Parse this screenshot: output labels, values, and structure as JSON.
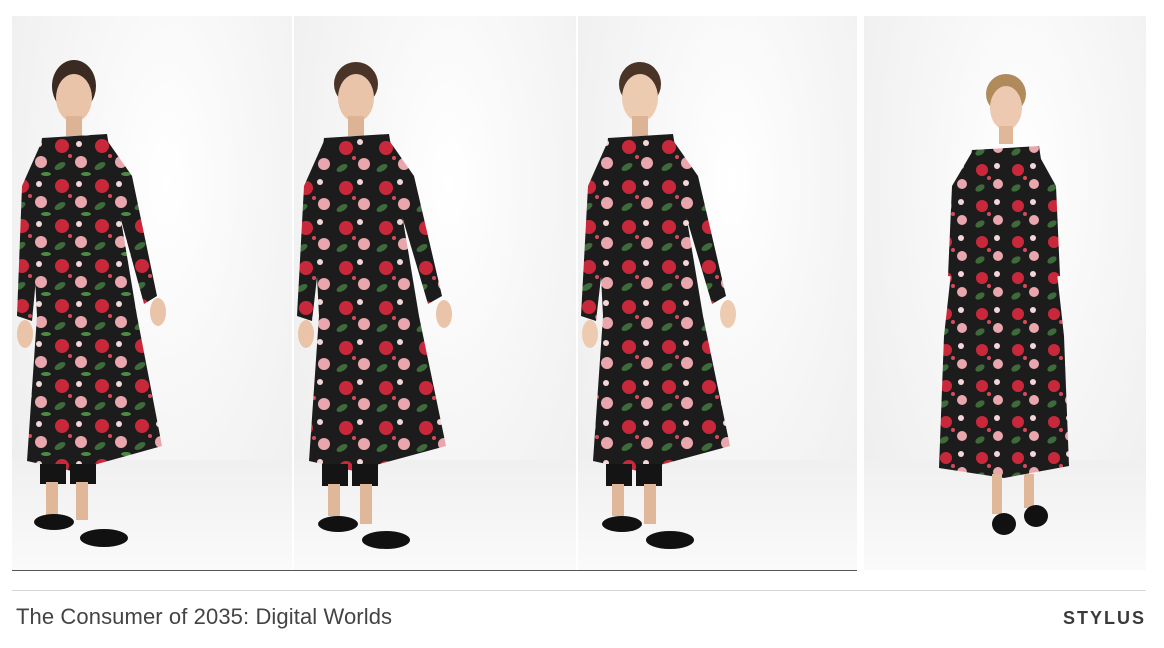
{
  "caption": {
    "title": "The Consumer of 2035: Digital Worlds"
  },
  "brand": {
    "name": "STYLUS"
  },
  "colors": {
    "dress_base": "#1c1c1c",
    "flower_red": "#c8283a",
    "flower_pink": "#e9a6ad",
    "leaf_green": "#3e6b3a",
    "skin": "#e9c4a8",
    "hair": "#3a2a22",
    "hair_blonde": "#b08a5a",
    "shoe": "#111111"
  }
}
